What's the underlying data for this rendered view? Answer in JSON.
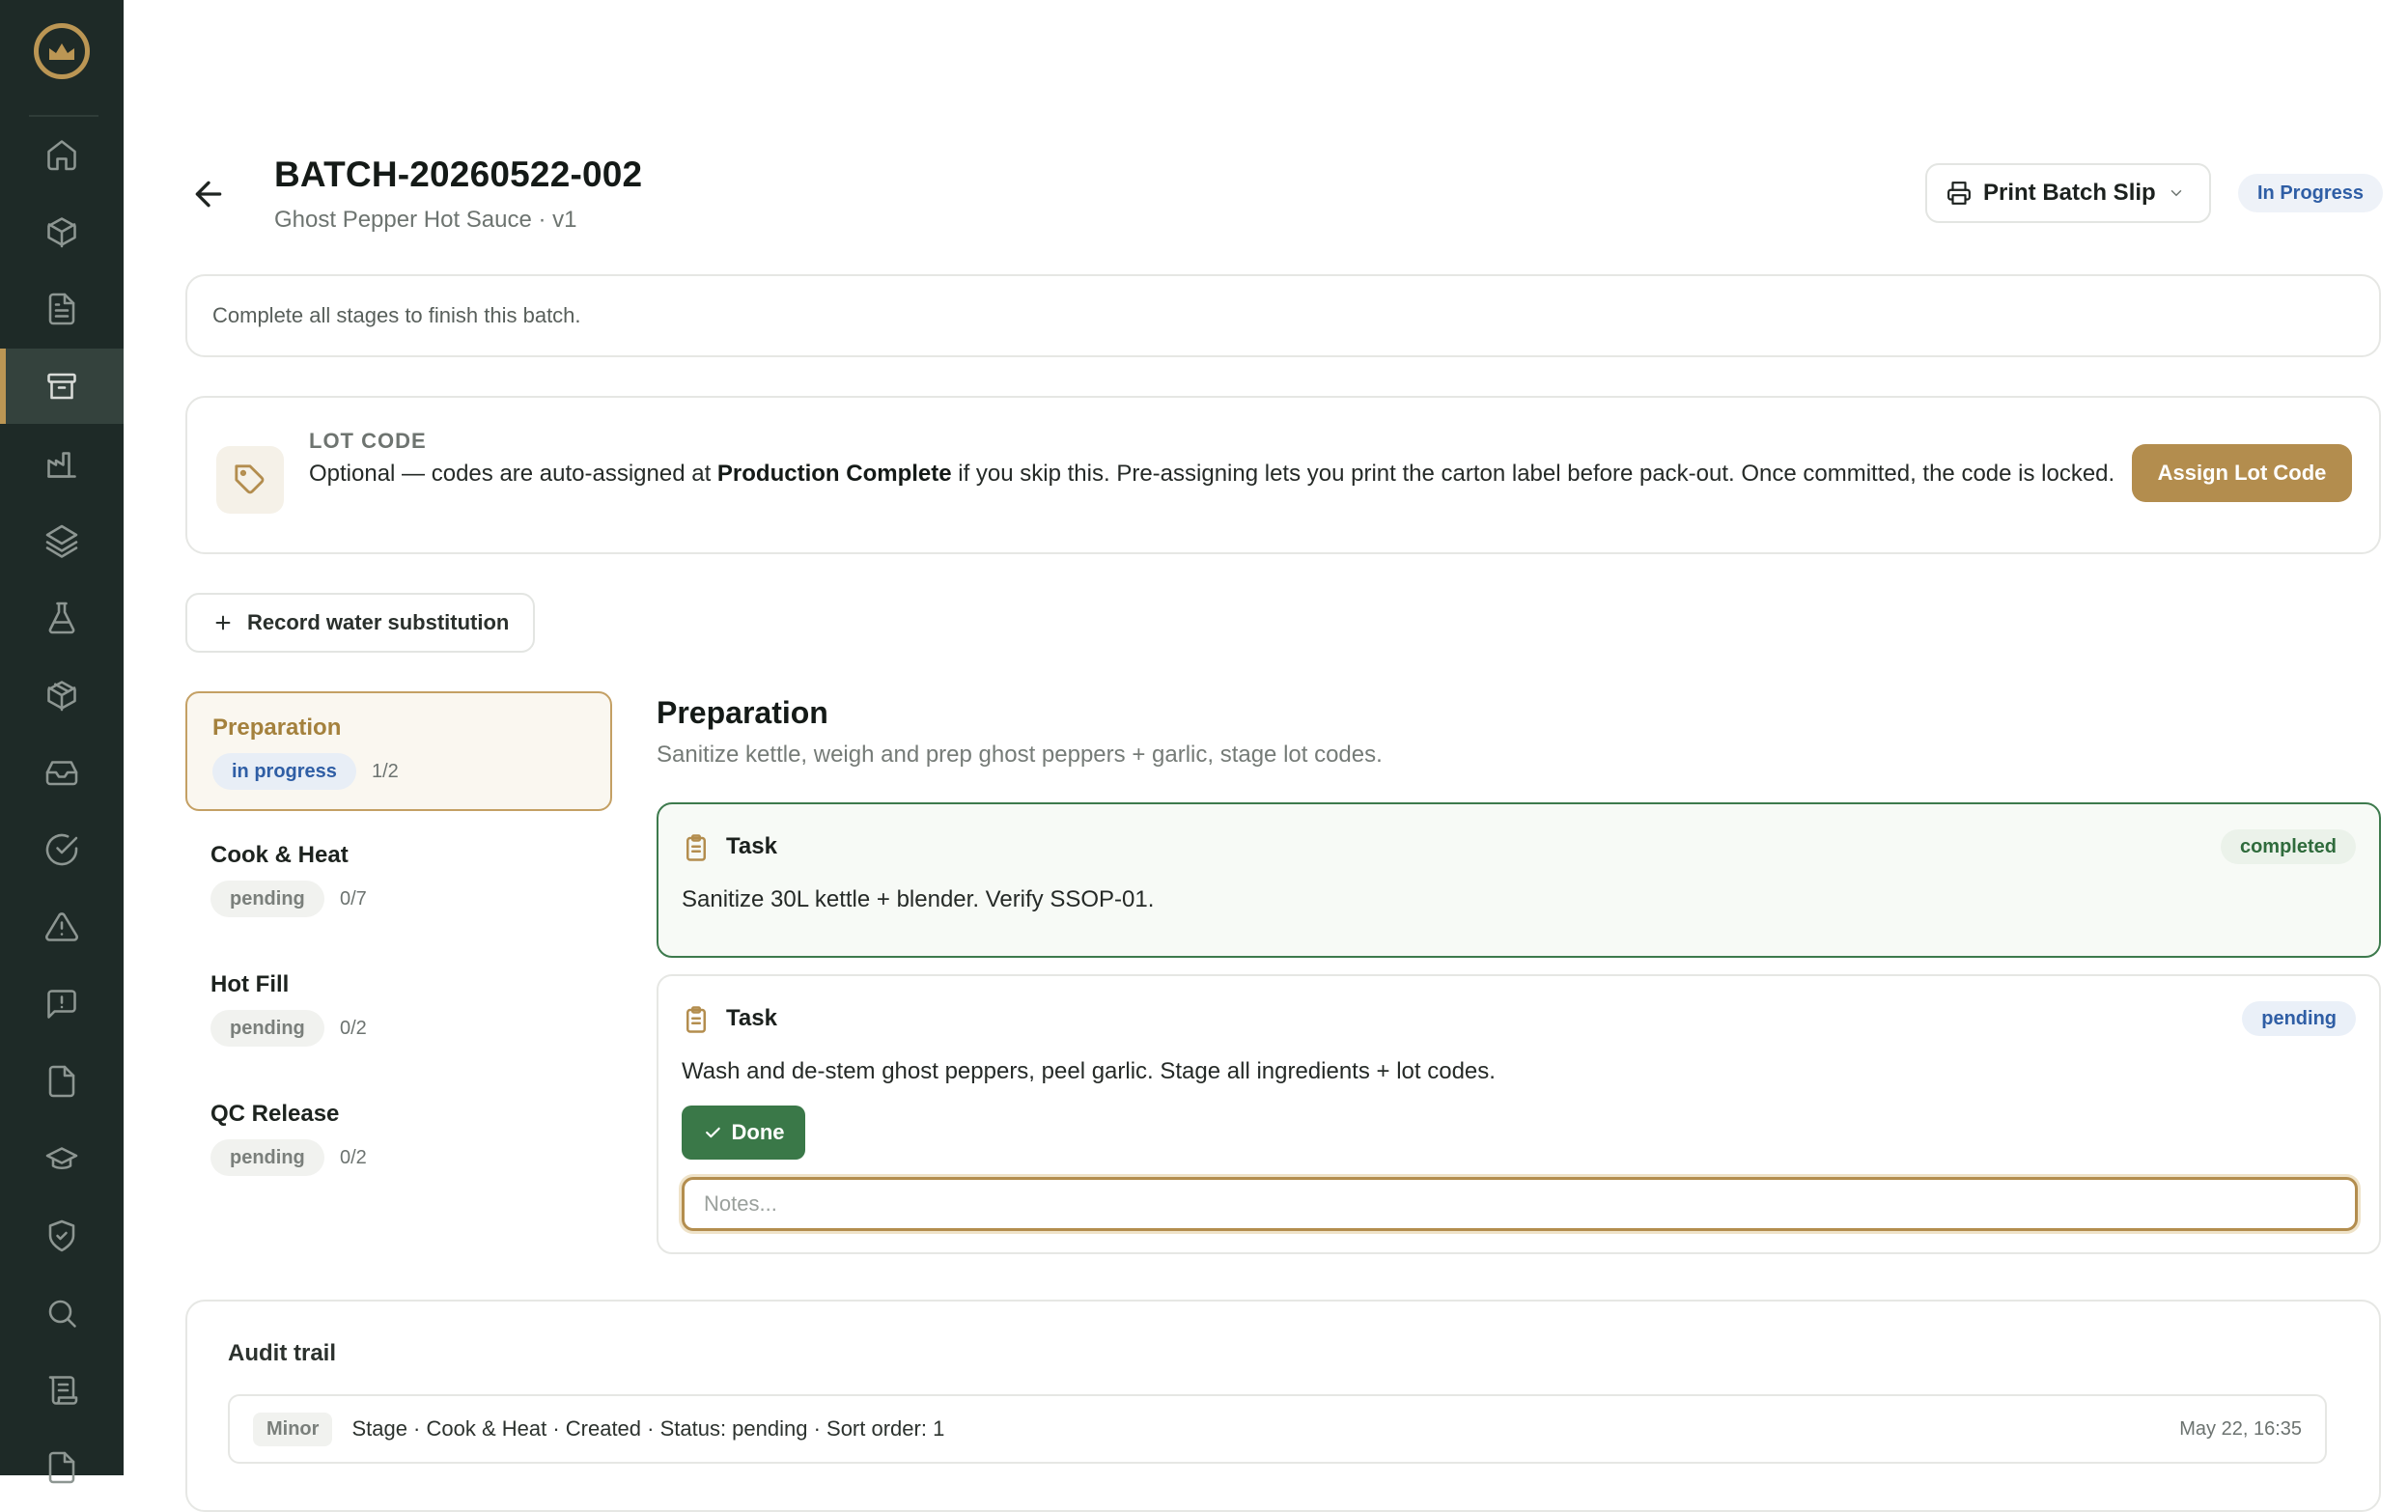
{
  "sidebar": {
    "items": [
      {
        "icon": "home-icon",
        "active": false
      },
      {
        "icon": "box-icon",
        "active": false
      },
      {
        "icon": "document-icon",
        "active": false
      },
      {
        "icon": "archive-icon",
        "active": true
      },
      {
        "icon": "factory-icon",
        "active": false
      },
      {
        "icon": "layers-icon",
        "active": false
      },
      {
        "icon": "flask-icon",
        "active": false
      },
      {
        "icon": "package-icon",
        "active": false
      },
      {
        "icon": "inbox-icon",
        "active": false
      },
      {
        "icon": "check-circle-icon",
        "active": false
      },
      {
        "icon": "warning-icon",
        "active": false
      },
      {
        "icon": "message-alert-icon",
        "active": false
      },
      {
        "icon": "file-icon",
        "active": false
      },
      {
        "icon": "graduation-cap-icon",
        "active": false
      },
      {
        "icon": "shield-check-icon",
        "active": false
      },
      {
        "icon": "search-icon",
        "active": false
      },
      {
        "icon": "scroll-icon",
        "active": false
      },
      {
        "icon": "export-icon",
        "active": false
      }
    ]
  },
  "header": {
    "title": "BATCH-20260522-002",
    "subtitle": "Ghost Pepper Hot Sauce · v1",
    "print_label": "Print Batch Slip",
    "status": "In Progress"
  },
  "banner": {
    "text": "Complete all stages to finish this batch."
  },
  "lot_code": {
    "heading": "LOT CODE",
    "desc_prefix": "Optional — codes are auto-assigned at ",
    "desc_bold": "Production Complete",
    "desc_suffix": " if you skip this. Pre-assigning lets you print the carton label before pack-out. Once committed, the code is locked.",
    "button": "Assign Lot Code"
  },
  "water_button": "Record water substitution",
  "stages": [
    {
      "name": "Preparation",
      "status": "in progress",
      "count": "1/2",
      "active": true
    },
    {
      "name": "Cook & Heat",
      "status": "pending",
      "count": "0/7",
      "active": false
    },
    {
      "name": "Hot Fill",
      "status": "pending",
      "count": "0/2",
      "active": false
    },
    {
      "name": "QC Release",
      "status": "pending",
      "count": "0/2",
      "active": false
    }
  ],
  "stage_detail": {
    "title": "Preparation",
    "description": "Sanitize kettle, weigh and prep ghost peppers + garlic, stage lot codes.",
    "tasks": [
      {
        "label": "Task",
        "text": "Sanitize 30L kettle + blender. Verify SSOP-01.",
        "status": "completed"
      },
      {
        "label": "Task",
        "text": "Wash and de-stem ghost peppers, peel garlic. Stage all ingredients + lot codes.",
        "status": "pending",
        "done_label": "Done",
        "notes_placeholder": "Notes...",
        "notes_value": ""
      }
    ]
  },
  "audit": {
    "title": "Audit trail",
    "entries": [
      {
        "severity": "Minor",
        "text": "Stage · Cook & Heat · Created · Status: pending · Sort order: 1",
        "time": "May 22, 16:35"
      }
    ]
  },
  "colors": {
    "sidebar_bg": "#1e2a27",
    "accent_gold": "#b38d4e",
    "success_green": "#3a7848",
    "status_blue": "#2f5ea5"
  }
}
